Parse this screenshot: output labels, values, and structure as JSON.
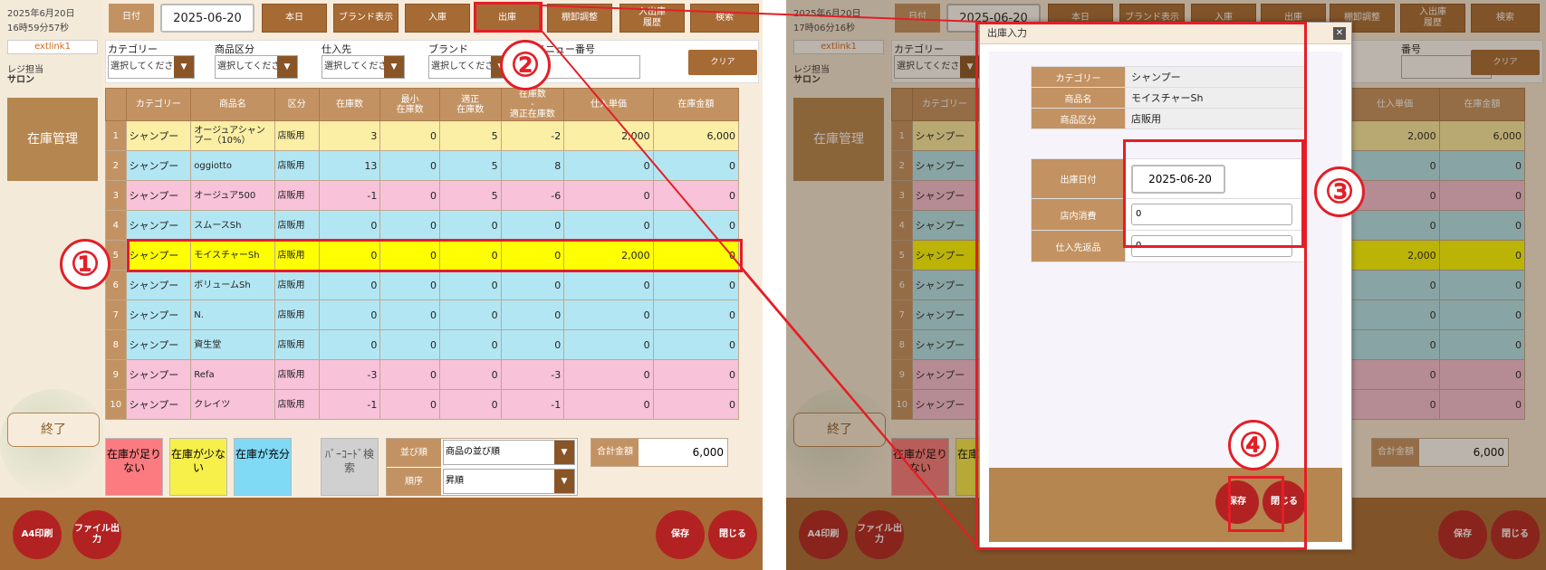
{
  "left": {
    "date": "2025年6月20日",
    "time": "16時59分57秒",
    "user": "extlink1",
    "staff_label": "レジ担当",
    "staff_name": "サロン",
    "menu": "在庫管理",
    "exit": "終了"
  },
  "right_side": {
    "time": "17時06分16秒",
    "date_truncated": "2025年6月20日"
  },
  "toolbar": {
    "date_label": "日付",
    "date_value": "2025-06-20",
    "today": "本日",
    "brand_display": "ブランド表示",
    "nyuko": "入庫",
    "shukko": "出庫",
    "tanaoroshi": "棚卸調整",
    "history_line1": "入出庫",
    "history_line2": "履歴",
    "search": "検索"
  },
  "filters": {
    "category_label": "カテゴリー",
    "category_value": "選択してくださ",
    "kubun_label": "商品区分",
    "kubun_value": "選択してくださ",
    "supplier_label": "仕入先",
    "supplier_value": "選択してくださ",
    "brand_label": "ブランド",
    "brand_value": "選択してくださ",
    "menu_no_label": "メニュー番号",
    "menu_no_label_right": "番号",
    "clear": "クリア"
  },
  "table": {
    "headers": [
      "カテゴリー",
      "商品名",
      "区分",
      "在庫数",
      "最小\n在庫数",
      "適正\n在庫数",
      "在庫数\n-\n適正在庫数",
      "仕入単価",
      "在庫金額"
    ],
    "rows": [
      {
        "no": "1",
        "cat": "シャンプー",
        "name": "オージュアシャンプー（10%）",
        "kubun": "店販用",
        "stock": "3",
        "min": "0",
        "proper": "5",
        "diff": "-2",
        "price": "2,000",
        "amount": "6,000",
        "color": "y"
      },
      {
        "no": "2",
        "cat": "シャンプー",
        "name": "oggiotto",
        "kubun": "店販用",
        "stock": "13",
        "min": "0",
        "proper": "5",
        "diff": "8",
        "price": "0",
        "amount": "0",
        "color": "b"
      },
      {
        "no": "3",
        "cat": "シャンプー",
        "name": "オージュア500",
        "kubun": "店販用",
        "stock": "-1",
        "min": "0",
        "proper": "5",
        "diff": "-6",
        "price": "0",
        "amount": "0",
        "color": "p"
      },
      {
        "no": "4",
        "cat": "シャンプー",
        "name": "スムースSh",
        "kubun": "店販用",
        "stock": "0",
        "min": "0",
        "proper": "0",
        "diff": "0",
        "price": "0",
        "amount": "0",
        "color": "b"
      },
      {
        "no": "5",
        "cat": "シャンプー",
        "name": "モイスチャーSh",
        "kubun": "店販用",
        "stock": "0",
        "min": "0",
        "proper": "0",
        "diff": "0",
        "price": "2,000",
        "amount": "0",
        "color": "h"
      },
      {
        "no": "6",
        "cat": "シャンプー",
        "name": "ボリュームSh",
        "kubun": "店販用",
        "stock": "0",
        "min": "0",
        "proper": "0",
        "diff": "0",
        "price": "0",
        "amount": "0",
        "color": "b"
      },
      {
        "no": "7",
        "cat": "シャンプー",
        "name": "N.",
        "kubun": "店販用",
        "stock": "0",
        "min": "0",
        "proper": "0",
        "diff": "0",
        "price": "0",
        "amount": "0",
        "color": "b"
      },
      {
        "no": "8",
        "cat": "シャンプー",
        "name": "資生堂",
        "kubun": "店販用",
        "stock": "0",
        "min": "0",
        "proper": "0",
        "diff": "0",
        "price": "0",
        "amount": "0",
        "color": "b"
      },
      {
        "no": "9",
        "cat": "シャンプー",
        "name": "Refa",
        "kubun": "店販用",
        "stock": "-3",
        "min": "0",
        "proper": "0",
        "diff": "-3",
        "price": "0",
        "amount": "0",
        "color": "p"
      },
      {
        "no": "10",
        "cat": "シャンプー",
        "name": "クレイツ",
        "kubun": "店販用",
        "stock": "-1",
        "min": "0",
        "proper": "0",
        "diff": "-1",
        "price": "0",
        "amount": "0",
        "color": "p"
      }
    ]
  },
  "status_buttons": {
    "shortage": "在庫が足りない",
    "low": "在庫が少ない",
    "enough": "在庫が充分",
    "barcode": "ﾊﾞｰｺｰﾄﾞ検索"
  },
  "sort": {
    "order_label": "並び順",
    "order_value": "商品の並び順",
    "direction_label": "順序",
    "direction_value": "昇順"
  },
  "total": {
    "label": "合計金額",
    "value": "6,000"
  },
  "footer": {
    "print": "A4印刷",
    "file": "ファイル出力",
    "save": "保存",
    "close": "閉じる"
  },
  "dialog": {
    "title": "出庫入力",
    "info": [
      {
        "k": "カテゴリー",
        "v": "シャンプー"
      },
      {
        "k": "商品名",
        "v": "モイスチャーSh"
      },
      {
        "k": "商品区分",
        "v": "店販用"
      }
    ],
    "date_label": "出庫日付",
    "date_value": "2025-06-20",
    "store_use_label": "店内消費",
    "store_use_value": "0",
    "return_label": "仕入先返品",
    "return_value": "0",
    "save": "保存",
    "close": "閉じる"
  },
  "callouts": [
    "①",
    "②",
    "③",
    "④"
  ],
  "colors": {
    "accent": "#a66a35",
    "header": "#c39262",
    "annotation": "#e41e26",
    "highlight": "#ffff00"
  }
}
